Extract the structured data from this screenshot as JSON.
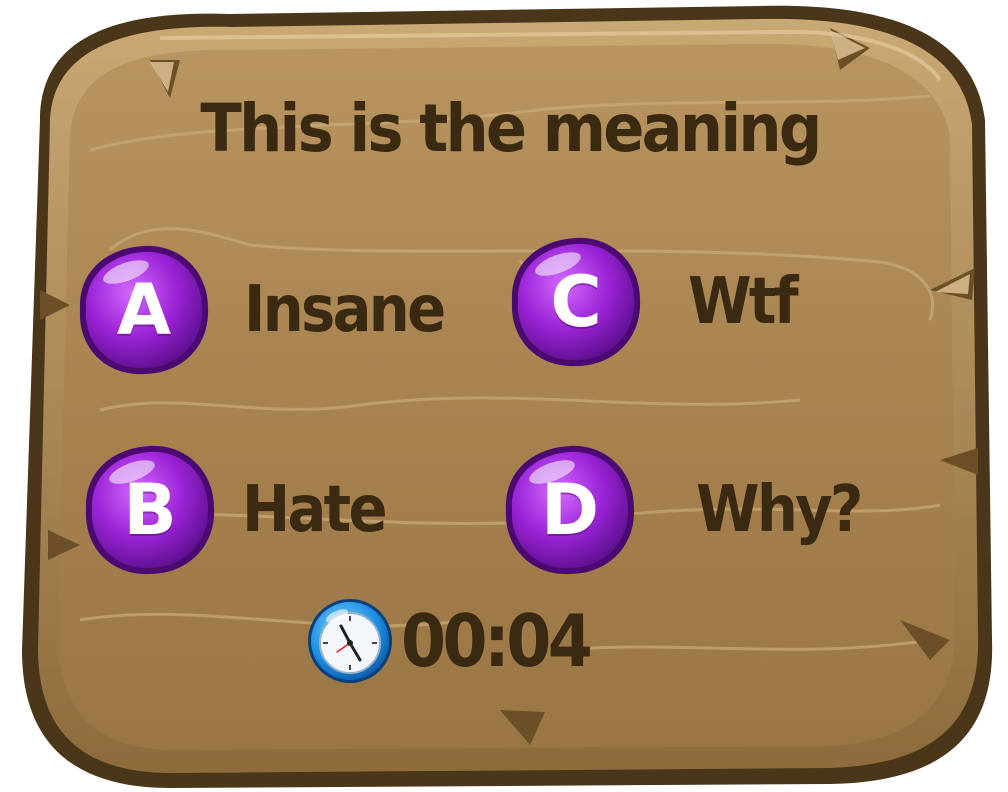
{
  "question": {
    "text": "This is the meaning"
  },
  "options": [
    {
      "letter": "A",
      "answer": "Insane"
    },
    {
      "letter": "B",
      "answer": "Hate"
    },
    {
      "letter": "C",
      "answer": "Wtf"
    },
    {
      "letter": "D",
      "answer": "Why?"
    }
  ],
  "timer": {
    "icon": "clock-icon",
    "value": "00:04"
  },
  "colors": {
    "board": "#a9844f",
    "board_edge": "#4a3619",
    "gem": "#8a1fc9",
    "text": "#3b2a12"
  }
}
